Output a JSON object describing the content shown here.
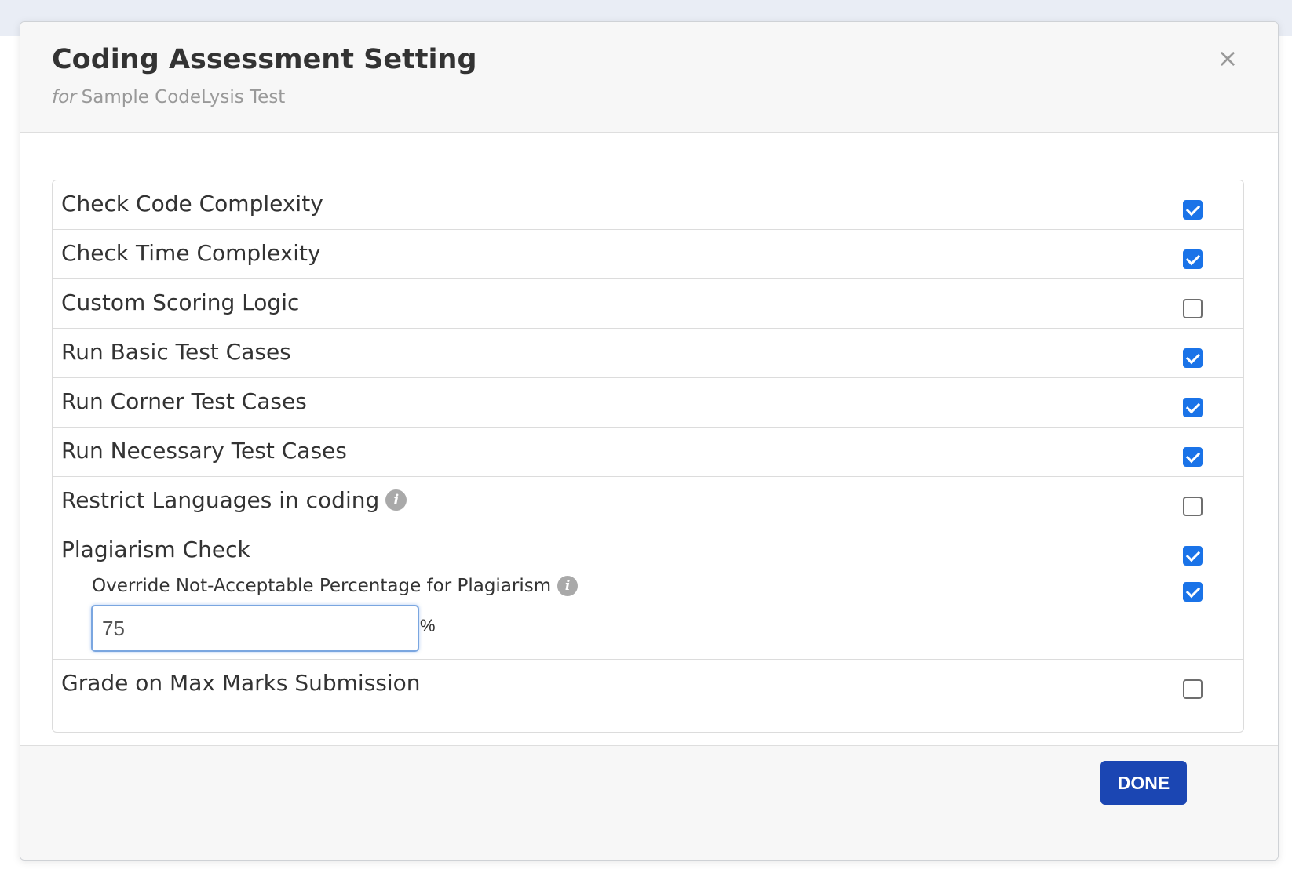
{
  "modal": {
    "title": "Coding Assessment Setting",
    "subtitle_prefix": "for",
    "subtitle_name": "Sample CodeLysis Test",
    "close_icon": "close-icon"
  },
  "settings": [
    {
      "label": "Check Code Complexity",
      "checked": true,
      "info": false
    },
    {
      "label": "Check Time Complexity",
      "checked": true,
      "info": false
    },
    {
      "label": "Custom Scoring Logic",
      "checked": false,
      "info": false
    },
    {
      "label": "Run Basic Test Cases",
      "checked": true,
      "info": false
    },
    {
      "label": "Run Corner Test Cases",
      "checked": true,
      "info": false
    },
    {
      "label": "Run Necessary Test Cases",
      "checked": true,
      "info": false
    },
    {
      "label": "Restrict Languages in coding",
      "checked": false,
      "info": true
    },
    {
      "label": "Plagiarism Check",
      "checked": true,
      "info": false
    },
    {
      "label": "Grade on Max Marks Submission",
      "checked": false,
      "info": false
    }
  ],
  "plagiarism": {
    "override_label": "Override Not-Acceptable Percentage for Plagiarism",
    "override_checked": true,
    "percentage_value": "75",
    "percent_sign": "%"
  },
  "footer": {
    "done_label": "DONE"
  },
  "colors": {
    "checkbox_accent": "#1a73e8",
    "done_button": "#1b46b3"
  }
}
